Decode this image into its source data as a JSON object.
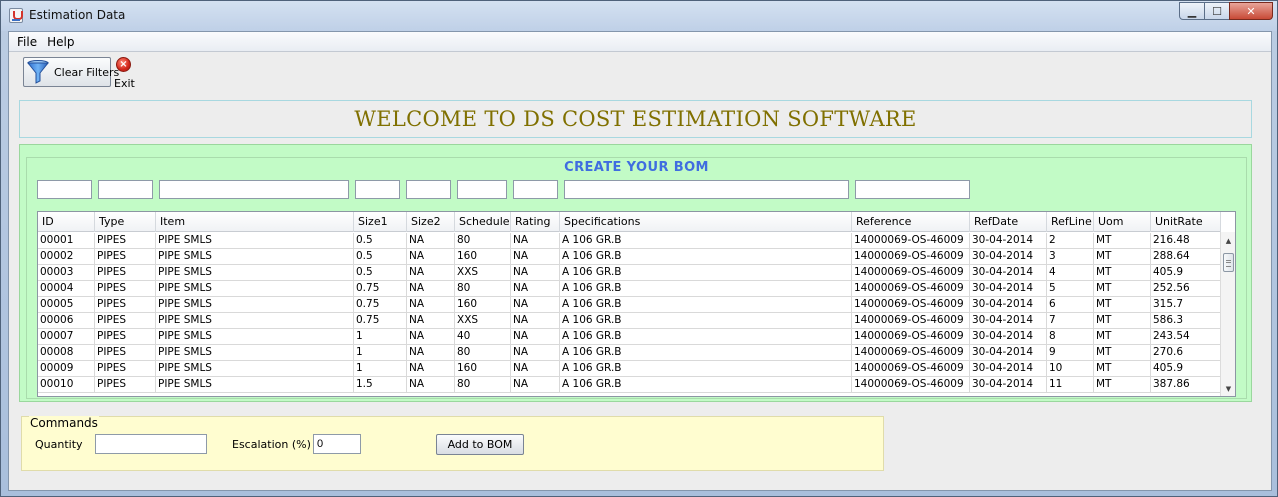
{
  "window": {
    "title": "Estimation Data",
    "controls": {
      "minimize": "▁",
      "maximize": "☐",
      "close": "✕"
    }
  },
  "menu": [
    "File",
    "Help"
  ],
  "toolbar": {
    "clear_filters_label": "Clear Filters",
    "exit_label": "Exit"
  },
  "welcome": "WELCOME TO DS COST ESTIMATION SOFTWARE",
  "bom": {
    "title": "CREATE YOUR BOM",
    "columns": [
      "ID",
      "Type",
      "Item",
      "Size1",
      "Size2",
      "Schedule",
      "Rating",
      "Specifications",
      "Reference",
      "RefDate",
      "RefLine",
      "Uom",
      "UnitRate"
    ],
    "rows": [
      [
        "00001",
        "PIPES",
        "PIPE SMLS",
        "0.5",
        "NA",
        "80",
        "NA",
        "A 106 GR.B",
        "14000069-OS-46009",
        "30-04-2014",
        "2",
        "MT",
        "216.48"
      ],
      [
        "00002",
        "PIPES",
        "PIPE SMLS",
        "0.5",
        "NA",
        "160",
        "NA",
        "A 106 GR.B",
        "14000069-OS-46009",
        "30-04-2014",
        "3",
        "MT",
        "288.64"
      ],
      [
        "00003",
        "PIPES",
        "PIPE SMLS",
        "0.5",
        "NA",
        "XXS",
        "NA",
        "A 106 GR.B",
        "14000069-OS-46009",
        "30-04-2014",
        "4",
        "MT",
        "405.9"
      ],
      [
        "00004",
        "PIPES",
        "PIPE SMLS",
        "0.75",
        "NA",
        "80",
        "NA",
        "A 106 GR.B",
        "14000069-OS-46009",
        "30-04-2014",
        "5",
        "MT",
        "252.56"
      ],
      [
        "00005",
        "PIPES",
        "PIPE SMLS",
        "0.75",
        "NA",
        "160",
        "NA",
        "A 106 GR.B",
        "14000069-OS-46009",
        "30-04-2014",
        "6",
        "MT",
        "315.7"
      ],
      [
        "00006",
        "PIPES",
        "PIPE SMLS",
        "0.75",
        "NA",
        "XXS",
        "NA",
        "A 106 GR.B",
        "14000069-OS-46009",
        "30-04-2014",
        "7",
        "MT",
        "586.3"
      ],
      [
        "00007",
        "PIPES",
        "PIPE SMLS",
        "1",
        "NA",
        "40",
        "NA",
        "A 106 GR.B",
        "14000069-OS-46009",
        "30-04-2014",
        "8",
        "MT",
        "243.54"
      ],
      [
        "00008",
        "PIPES",
        "PIPE SMLS",
        "1",
        "NA",
        "80",
        "NA",
        "A 106 GR.B",
        "14000069-OS-46009",
        "30-04-2014",
        "9",
        "MT",
        "270.6"
      ],
      [
        "00009",
        "PIPES",
        "PIPE SMLS",
        "1",
        "NA",
        "160",
        "NA",
        "A 106 GR.B",
        "14000069-OS-46009",
        "30-04-2014",
        "10",
        "MT",
        "405.9"
      ],
      [
        "00010",
        "PIPES",
        "PIPE SMLS",
        "1.5",
        "NA",
        "80",
        "NA",
        "A 106 GR.B",
        "14000069-OS-46009",
        "30-04-2014",
        "11",
        "MT",
        "387.86"
      ]
    ]
  },
  "commands": {
    "legend": "Commands",
    "quantity_label": "Quantity",
    "quantity_value": "",
    "escalation_label": "Escalation (%)",
    "escalation_value": "0",
    "add_button": "Add to BOM"
  },
  "colors": {
    "welcome_text": "#807000",
    "bom_title": "#3f6de0",
    "bom_background": "#c2fbc6",
    "commands_background": "#fffdd0"
  },
  "icons": {
    "clear_filters": "funnel-icon",
    "exit": "close-circle-icon",
    "scroll_up": "arrow-up-icon",
    "scroll_down": "arrow-down-icon"
  }
}
